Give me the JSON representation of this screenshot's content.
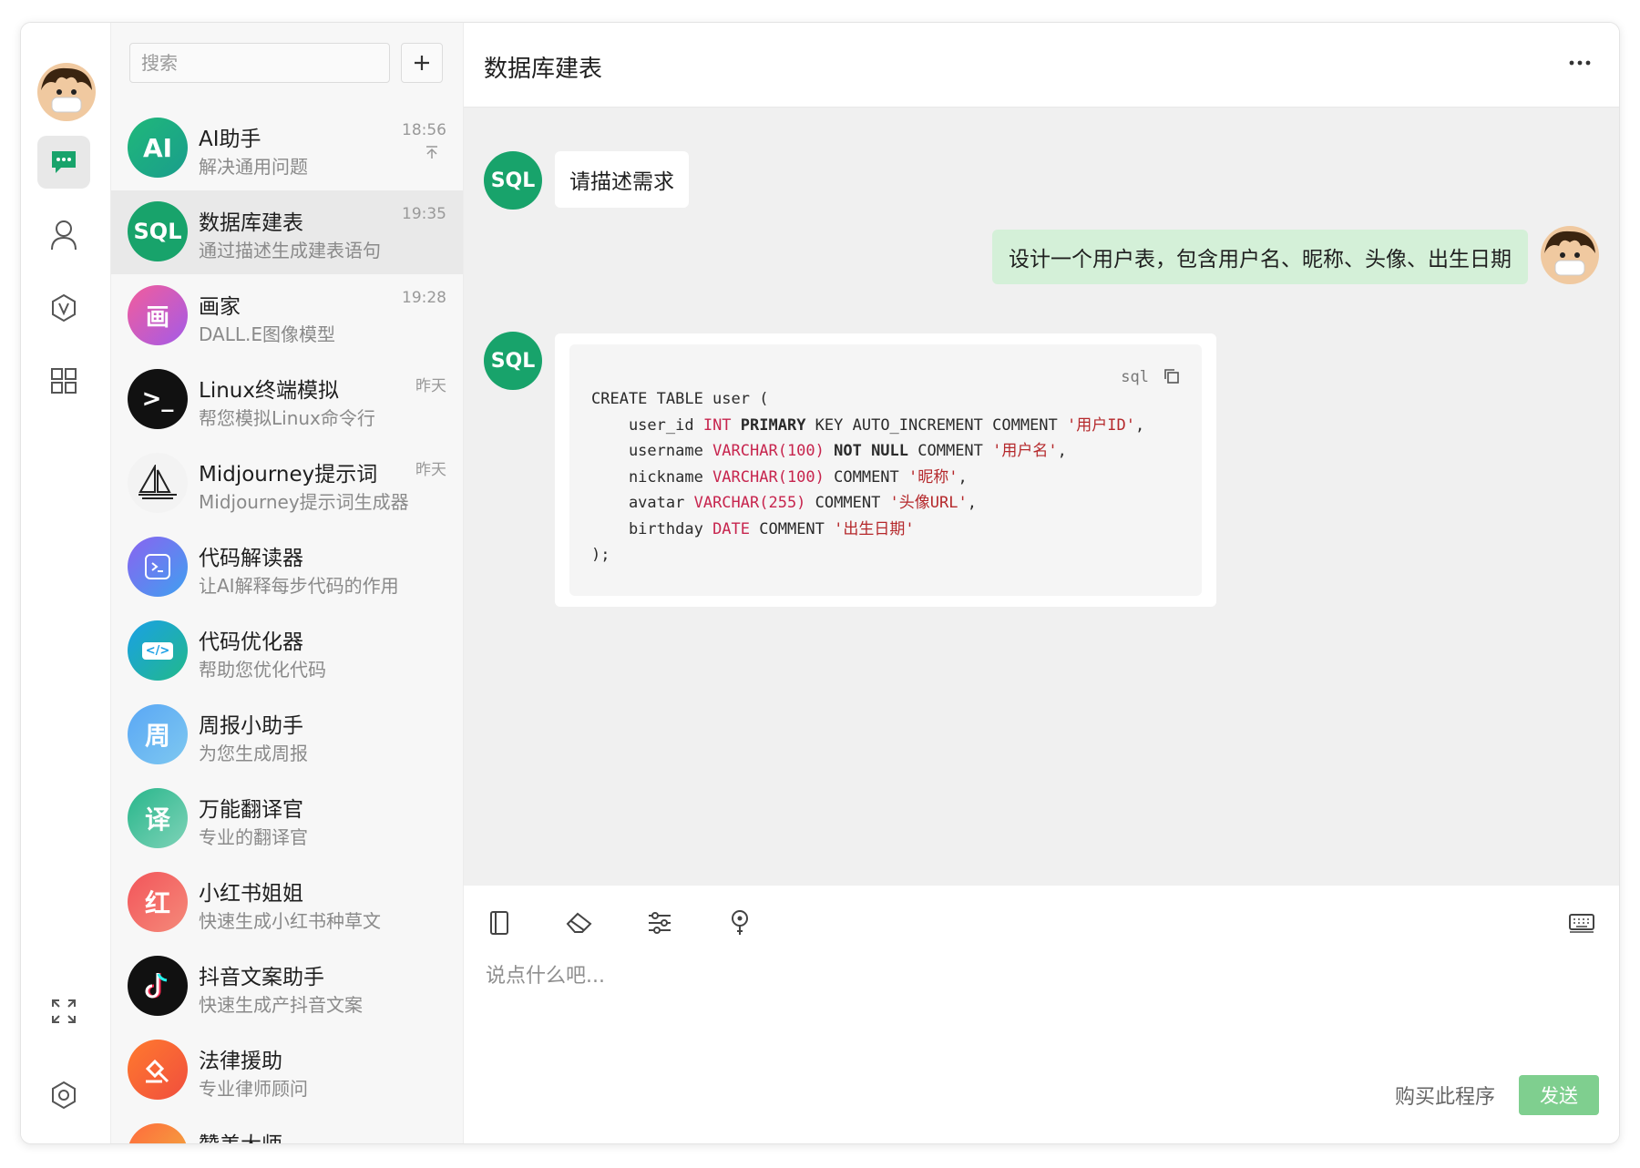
{
  "rail": {
    "items": [
      "chat-icon",
      "contacts-icon",
      "vip-icon",
      "apps-icon"
    ],
    "bottom": [
      "fullscreen-icon",
      "settings-icon"
    ],
    "accent": "#18a36b"
  },
  "search": {
    "placeholder": "搜索"
  },
  "sessions": [
    {
      "name": "AI助手",
      "desc": "解决通用问题",
      "time": "18:56",
      "pinned": true,
      "avatar_text": "AI"
    },
    {
      "name": "数据库建表",
      "desc": "通过描述生成建表语句",
      "time": "19:35",
      "avatar_text": "SQL"
    },
    {
      "name": "画家",
      "desc": "DALL.E图像模型",
      "time": "19:28",
      "avatar_text": "画"
    },
    {
      "name": "Linux终端模拟",
      "desc": "帮您模拟Linux命令行",
      "time": "昨天",
      "avatar_text": ">_"
    },
    {
      "name": "Midjourney提示词",
      "desc": "Midjourney提示词生成器",
      "time": "昨天",
      "avatar_text": ""
    },
    {
      "name": "代码解读器",
      "desc": "让AI解释每步代码的作用",
      "time": "",
      "avatar_text": ""
    },
    {
      "name": "代码优化器",
      "desc": "帮助您优化代码",
      "time": "",
      "avatar_text": "</>"
    },
    {
      "name": "周报小助手",
      "desc": "为您生成周报",
      "time": "",
      "avatar_text": "周"
    },
    {
      "name": "万能翻译官",
      "desc": "专业的翻译官",
      "time": "",
      "avatar_text": "译"
    },
    {
      "name": "小红书姐姐",
      "desc": "快速生成小红书种草文",
      "time": "",
      "avatar_text": "红"
    },
    {
      "name": "抖音文案助手",
      "desc": "快速生成产抖音文案",
      "time": "",
      "avatar_text": ""
    },
    {
      "name": "法律援助",
      "desc": "专业律师顾问",
      "time": "",
      "avatar_text": ""
    },
    {
      "name": "赞美大师",
      "desc": "",
      "time": "",
      "avatar_text": ""
    }
  ],
  "chat": {
    "title": "数据库建表",
    "bot_avatar_text": "SQL",
    "messages": [
      {
        "role": "bot",
        "text": "请描述需求"
      },
      {
        "role": "user",
        "text": "设计一个用户表，包含用户名、昵称、头像、出生日期"
      }
    ],
    "code": {
      "lang": "sql",
      "line1": "CREATE TABLE user (",
      "l2a": "    user_id ",
      "l2b": "INT",
      "l2c": " PRIMARY",
      "l2d": " KEY AUTO_INCREMENT COMMENT ",
      "l2e": "'用户ID'",
      "l2f": ",",
      "l3a": "    username ",
      "l3b": "VARCHAR(100)",
      "l3c": " NOT NULL",
      "l3d": " COMMENT ",
      "l3e": "'用户名'",
      "l3f": ",",
      "l4a": "    nickname ",
      "l4b": "VARCHAR(100)",
      "l4d": " COMMENT ",
      "l4e": "'昵称'",
      "l4f": ",",
      "l5a": "    avatar ",
      "l5b": "VARCHAR(255)",
      "l5d": " COMMENT ",
      "l5e": "'头像URL'",
      "l5f": ",",
      "l6a": "    birthday ",
      "l6b": "DATE",
      "l6d": " COMMENT ",
      "l6e": "'出生日期'",
      "line7": ");"
    }
  },
  "composer": {
    "placeholder": "说点什么吧...",
    "buy_label": "购买此程序",
    "send_label": "发送",
    "tools": [
      "notebook-icon",
      "eraser-icon",
      "sliders-icon",
      "pin-icon"
    ],
    "keyboard_icon": "keyboard-icon"
  }
}
